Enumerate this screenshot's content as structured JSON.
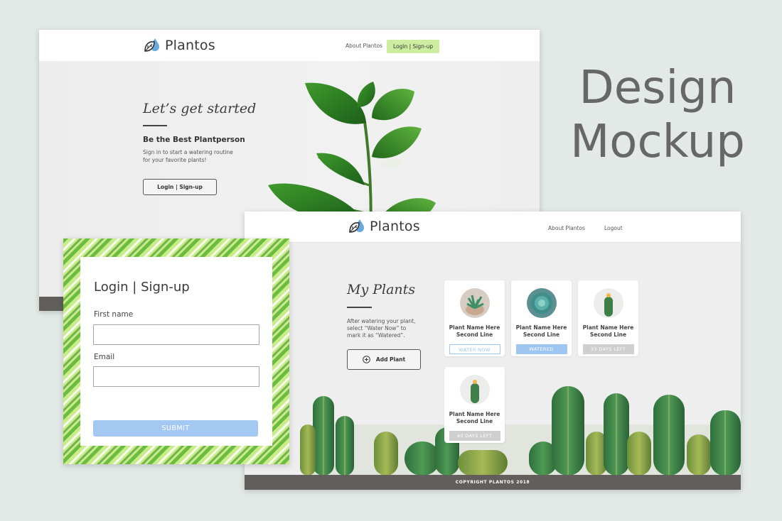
{
  "heading": {
    "line1": "Design",
    "line2": "Mockup"
  },
  "brand": {
    "name": "Plantos"
  },
  "landing": {
    "nav": {
      "about": "About Plantos",
      "cta": "Login | Sign-up"
    },
    "hero": {
      "title": "Let’s get started",
      "subtitle": "Be the Best Plantperson",
      "body_line1": "Sign in to start a watering routine",
      "body_line2": "for your favorite plants!",
      "button": "Login | Sign-up"
    }
  },
  "dashboard": {
    "nav": {
      "about": "About Plantos",
      "logout": "Logout"
    },
    "title": "My Plants",
    "instructions": [
      "After watering your plant,",
      "select “Water Now” to",
      "mark it as “Watered”."
    ],
    "add_button": "Add Plant",
    "plants": [
      {
        "name_line1": "Plant Name Here",
        "name_line2": "Second Line",
        "status": "WATER NOW"
      },
      {
        "name_line1": "Plant Name Here",
        "name_line2": "Second Line",
        "status": "WATERED"
      },
      {
        "name_line1": "Plant Name Here",
        "name_line2": "Second Line",
        "status": "33 DAYS LEFT"
      },
      {
        "name_line1": "Plant Name Here",
        "name_line2": "Second Line",
        "status": "40 DAYS LEFT"
      }
    ],
    "footer": "COPYRIGHT PLANTOS 2018"
  },
  "login_form": {
    "title": "Login | Sign-up",
    "first_name_label": "First name",
    "first_name_value": "",
    "email_label": "Email",
    "email_value": "",
    "submit": "SUBMIT"
  },
  "colors": {
    "background": "#e3e9e6",
    "accent_green": "#cdeea0",
    "accent_blue": "#9ec6f0",
    "footer_gray": "#615e5b",
    "heading_gray": "#676767"
  },
  "icons": [
    "leaf-drop-logo-icon",
    "plus-circle-icon"
  ]
}
